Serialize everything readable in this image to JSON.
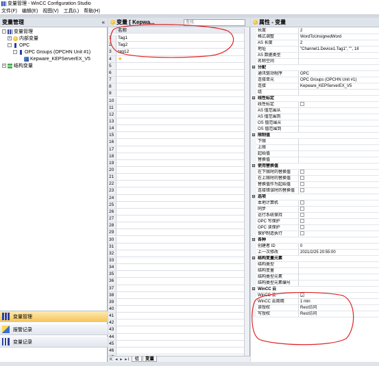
{
  "window": {
    "title": "变量管理 - WinCC Configuration Studio"
  },
  "menu": [
    "文件(F)",
    "编辑(E)",
    "视图(V)",
    "工具(L)",
    "帮助(H)"
  ],
  "left": {
    "title": "变量管理",
    "collapse": "«",
    "tree": [
      {
        "label": "变量管理",
        "indent": 0,
        "exp": "-",
        "icon": "bars"
      },
      {
        "label": "内部变量",
        "indent": 1,
        "exp": "+",
        "icon": "globe"
      },
      {
        "label": "OPC",
        "indent": 1,
        "exp": "-",
        "icon": "bar1"
      },
      {
        "label": "OPC Groups (OPCHN Unit #1)",
        "indent": 2,
        "exp": "-",
        "icon": "bar1"
      },
      {
        "label": "Kepware_KEPServerEX_V5",
        "indent": 3,
        "exp": "",
        "icon": "tag"
      },
      {
        "label": "结构变量",
        "indent": 0,
        "exp": "+",
        "icon": "struct"
      }
    ],
    "split_dots": "....",
    "nav": [
      {
        "label": "变量管理",
        "icon": "bars",
        "active": true
      },
      {
        "label": "报警记录",
        "icon": "alarm",
        "active": false
      },
      {
        "label": "变量记录",
        "icon": "log",
        "active": false
      }
    ]
  },
  "middle": {
    "title": "变量 [ Kepwa...",
    "search_placeholder": "查找",
    "column_header": "名称",
    "rows": [
      "Tag1",
      "Tag2",
      "tag12",
      "",
      "",
      "",
      "",
      "",
      "",
      "",
      "",
      "",
      "",
      "",
      "",
      "",
      "",
      "",
      "",
      "",
      "",
      "",
      "",
      "",
      "",
      "",
      "",
      "",
      "",
      "",
      "",
      "",
      "",
      "",
      "",
      "",
      "",
      "",
      "",
      "",
      "",
      "",
      "",
      "",
      "",
      "",
      "",
      "",
      "",
      "",
      "",
      "",
      "",
      "",
      "",
      "",
      ""
    ],
    "row_numbers": [
      "1",
      "2",
      "3",
      "4",
      "5",
      "6",
      "7",
      "8",
      "9",
      "10",
      "11",
      "12",
      "13",
      "14",
      "15",
      "16",
      "17",
      "18",
      "19",
      "20",
      "21",
      "22",
      "23",
      "24",
      "25",
      "26",
      "27",
      "28",
      "29",
      "30",
      "31",
      "32",
      "33",
      "34",
      "35",
      "36",
      "37",
      "38",
      "39",
      "40",
      "41",
      "42",
      "43",
      "44",
      "45",
      "46",
      "47"
    ],
    "tabs": [
      "组",
      "变量"
    ],
    "tab_arrows": "K ◂ ▸ ▸I"
  },
  "right": {
    "title": "属性 - 变量",
    "rows": [
      {
        "k": "长度",
        "v": "2"
      },
      {
        "k": "格式调整",
        "v": "WordToUnsignedWord"
      },
      {
        "k": "AS 长度",
        "v": "2"
      },
      {
        "k": "地址",
        "v": "\"Channel1.Device1.Tag1\", \"\", 18"
      },
      {
        "k": "AS 数据类型",
        "v": ""
      },
      {
        "k": "名称空间",
        "v": ""
      },
      {
        "section": "分配"
      },
      {
        "k": "通讯驱动程序",
        "v": "OPC"
      },
      {
        "k": "连接单元",
        "v": "OPC Groups (OPCHN Unit #1)"
      },
      {
        "k": "连接",
        "v": "Kepware_KEPServerEX_V5"
      },
      {
        "k": "组",
        "v": ""
      },
      {
        "section": "线性标定"
      },
      {
        "k": "线性标定",
        "chk": ""
      },
      {
        "k": "AS 值范围从",
        "v": ""
      },
      {
        "k": "AS 值范围到",
        "v": ""
      },
      {
        "k": "OS 值范围从",
        "v": ""
      },
      {
        "k": "OS 值范围到",
        "v": ""
      },
      {
        "section": "限制值"
      },
      {
        "k": "下限",
        "v": ""
      },
      {
        "k": "上限",
        "v": ""
      },
      {
        "k": "起始值",
        "v": ""
      },
      {
        "k": "替换值",
        "v": ""
      },
      {
        "section": "使用替换值"
      },
      {
        "k": "在下限时的替换值",
        "chk": ""
      },
      {
        "k": "在上限时的替换值",
        "chk": ""
      },
      {
        "k": "替换值作为起始值",
        "chk": ""
      },
      {
        "k": "连接错误时的替换值",
        "chk": ""
      },
      {
        "section": "选项"
      },
      {
        "k": "本地计算机",
        "chk": ""
      },
      {
        "k": "同步",
        "chk": ""
      },
      {
        "k": "运行系统保持",
        "chk": ""
      },
      {
        "k": "OPC 写保护",
        "chk": ""
      },
      {
        "k": "OPC 读保护",
        "chk": ""
      },
      {
        "k": "保护制造执行",
        "chk": ""
      },
      {
        "section": "各种"
      },
      {
        "k": "创建者 ID",
        "v": "0"
      },
      {
        "k": "上一次修改",
        "v": "2021/2/25 20:55:00"
      },
      {
        "section": "结构变量元素"
      },
      {
        "k": "结构类型",
        "v": ""
      },
      {
        "k": "结构变量",
        "v": ""
      },
      {
        "k": "结构类型元素",
        "v": ""
      },
      {
        "k": "结构类型元素编号",
        "v": ""
      },
      {
        "section": "WinCC 云"
      },
      {
        "k": "WinCC 云",
        "chk": "✓"
      },
      {
        "k": "WinCC 云周期",
        "v": "1 min"
      },
      {
        "k": "读授权",
        "v": "Rest访问"
      },
      {
        "k": "写授权",
        "v": "Rest访问"
      }
    ]
  },
  "colors": {
    "accent": "#f6c65a",
    "header": "#dfe3ea",
    "annotation": "#e02020"
  }
}
